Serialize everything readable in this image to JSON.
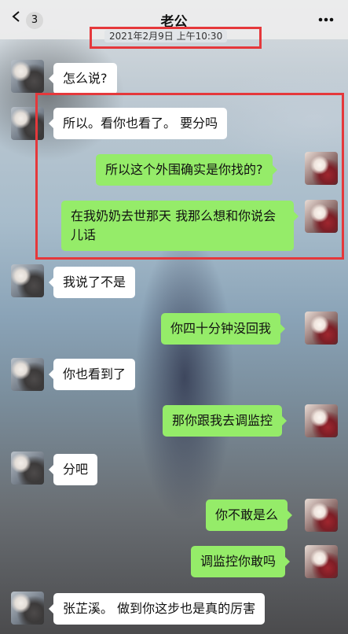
{
  "header": {
    "title": "老公",
    "unread_count": "3",
    "back_icon": "chevron-left-icon",
    "more_icon": "more-dots-icon",
    "timestamp": "2021年2月9日 上午10:30"
  },
  "colors": {
    "incoming_bubble": "#ffffff",
    "outgoing_bubble": "#95ec69",
    "highlight_box": "#e5383b",
    "navbar": "#ededed"
  },
  "messages": [
    {
      "side": "in",
      "text": "怎么说?"
    },
    {
      "side": "in",
      "text": "所以。看你也看了。 要分吗"
    },
    {
      "side": "out",
      "text": "所以这个外围确实是你找的?"
    },
    {
      "side": "out",
      "text": "在我奶奶去世那天 我那么想和你说会儿话"
    },
    {
      "side": "in",
      "text": "我说了不是"
    },
    {
      "side": "out",
      "text": "你四十分钟没回我"
    },
    {
      "side": "in",
      "text": "你也看到了"
    },
    {
      "side": "out",
      "text": "那你跟我去调监控"
    },
    {
      "side": "in",
      "text": "分吧"
    },
    {
      "side": "out",
      "text": "你不敢是么"
    },
    {
      "side": "out",
      "text": "调监控你敢吗"
    },
    {
      "side": "in",
      "text": "张芷溪。 做到你这步也是真的厉害"
    }
  ]
}
